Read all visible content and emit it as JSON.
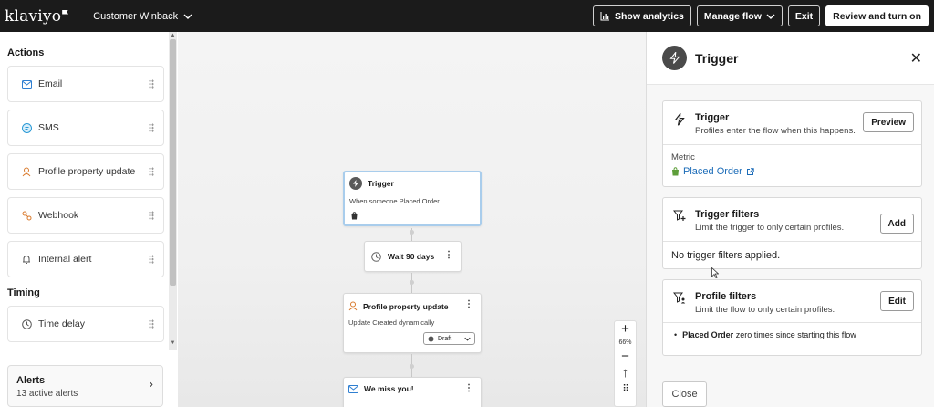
{
  "topbar": {
    "logo": "klaviyo",
    "flow_name": "Customer Winback",
    "show_analytics": "Show analytics",
    "manage_flow": "Manage flow",
    "exit": "Exit",
    "review": "Review and turn on"
  },
  "sidebar": {
    "actions_heading": "Actions",
    "actions": [
      {
        "label": "Email",
        "icon": "email-icon"
      },
      {
        "label": "SMS",
        "icon": "sms-icon"
      },
      {
        "label": "Profile property update",
        "icon": "person-icon"
      },
      {
        "label": "Webhook",
        "icon": "webhook-icon"
      },
      {
        "label": "Internal alert",
        "icon": "bell-icon"
      }
    ],
    "timing_heading": "Timing",
    "timing": [
      {
        "label": "Time delay",
        "icon": "clock-icon"
      }
    ],
    "alerts": {
      "title": "Alerts",
      "subtitle": "13 active alerts"
    }
  },
  "canvas": {
    "trigger_node": {
      "title": "Trigger",
      "subtitle": "When someone Placed Order"
    },
    "wait_node": {
      "title": "Wait 90 days"
    },
    "profile_node": {
      "title": "Profile property update",
      "subtitle": "Update Created dynamically",
      "status": "Draft"
    },
    "email_node": {
      "title": "We miss you!"
    },
    "zoom": {
      "level": "66%"
    }
  },
  "panel": {
    "title": "Trigger",
    "trigger_card": {
      "title": "Trigger",
      "subtitle": "Profiles enter the flow when this happens.",
      "button": "Preview",
      "metric_label": "Metric",
      "metric_value": "Placed Order"
    },
    "trigger_filters": {
      "title": "Trigger filters",
      "subtitle": "Limit the trigger to only certain profiles.",
      "button": "Add",
      "empty": "No trigger filters applied."
    },
    "profile_filters": {
      "title": "Profile filters",
      "subtitle": "Limit the flow to only certain profiles.",
      "button": "Edit",
      "rule_bold": "Placed Order",
      "rule_rest": " zero times since starting this flow"
    },
    "close_button": "Close"
  }
}
